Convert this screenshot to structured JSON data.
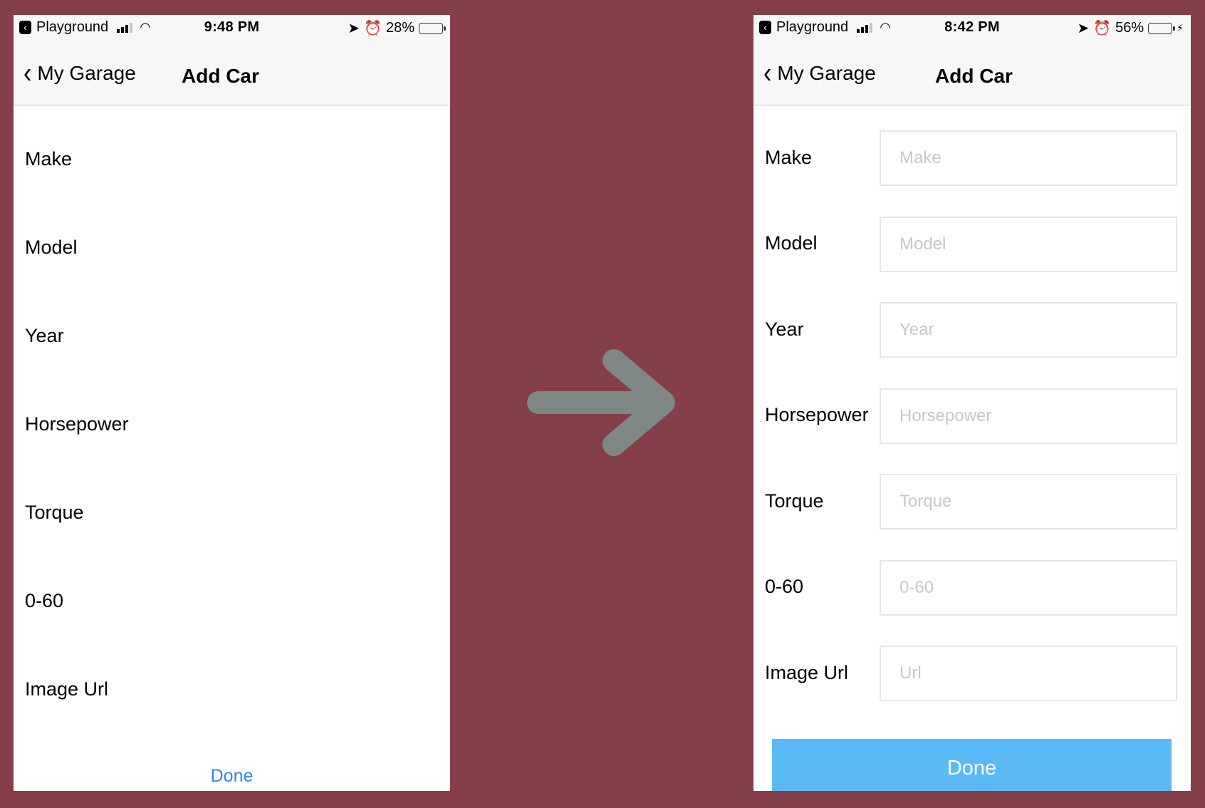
{
  "before": {
    "status": {
      "carrier": "Playground",
      "time": "9:48 PM",
      "battery_pct": "28%",
      "battery_level": 0.28,
      "battery_color": "#000000",
      "charging": false
    },
    "nav": {
      "back_label": "My Garage",
      "title": "Add Car"
    },
    "fields": [
      "Make",
      "Model",
      "Year",
      "Horsepower",
      "Torque",
      "0-60",
      "Image Url"
    ],
    "done_label": "Done"
  },
  "after": {
    "status": {
      "carrier": "Playground",
      "time": "8:42 PM",
      "battery_pct": "56%",
      "battery_level": 0.56,
      "battery_color": "#5fd36b",
      "charging": true
    },
    "nav": {
      "back_label": "My Garage",
      "title": "Add Car"
    },
    "fields": [
      {
        "label": "Make",
        "placeholder": "Make"
      },
      {
        "label": "Model",
        "placeholder": "Model"
      },
      {
        "label": "Year",
        "placeholder": "Year"
      },
      {
        "label": "Horsepower",
        "placeholder": "Horsepower"
      },
      {
        "label": "Torque",
        "placeholder": "Torque"
      },
      {
        "label": "0-60",
        "placeholder": "0-60"
      },
      {
        "label": "Image Url",
        "placeholder": "Url"
      }
    ],
    "done_label": "Done"
  },
  "colors": {
    "background": "#843f48",
    "arrow": "#7f8785",
    "done_button": "#5bbaf5",
    "done_link": "#2f86f6"
  },
  "icons": {
    "arrow": "right-arrow-icon",
    "back": "chevron-left-icon"
  }
}
